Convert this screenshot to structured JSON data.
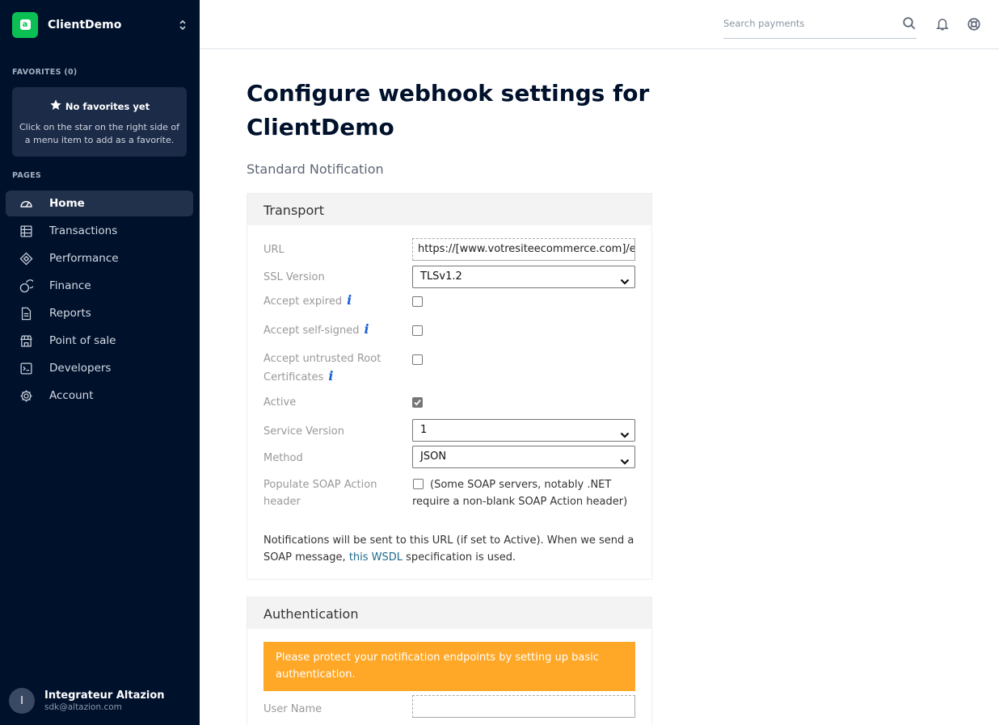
{
  "app": {
    "name": "ClientDemo",
    "logo_letter": "a",
    "brand_color": "#0abf53"
  },
  "sidebar": {
    "favorites_label": "FAVORITES (0)",
    "favorites_empty_title": "No favorites yet",
    "favorites_empty_desc": "Click on the star on the right side of a menu item to add as a favorite.",
    "pages_label": "PAGES",
    "items": [
      {
        "label": "Home",
        "icon": "dashboard-icon",
        "active": true
      },
      {
        "label": "Transactions",
        "icon": "table-icon",
        "active": false
      },
      {
        "label": "Performance",
        "icon": "performance-icon",
        "active": false
      },
      {
        "label": "Finance",
        "icon": "finance-icon",
        "active": false
      },
      {
        "label": "Reports",
        "icon": "document-icon",
        "active": false
      },
      {
        "label": "Point of sale",
        "icon": "store-icon",
        "active": false
      },
      {
        "label": "Developers",
        "icon": "terminal-icon",
        "active": false
      },
      {
        "label": "Account",
        "icon": "gear-icon",
        "active": false
      }
    ],
    "user": {
      "initial": "I",
      "name": "Integrateur Altazion",
      "email": "sdk@altazion.com"
    }
  },
  "topbar": {
    "search_placeholder": "Search payments"
  },
  "main": {
    "title": "Configure webhook settings for ClientDemo",
    "subtitle": "Standard Notification",
    "transport": {
      "heading": "Transport",
      "url_label": "URL",
      "url_value": "https://[www.votresiteecommerce.com]/exe",
      "ssl_label": "SSL Version",
      "ssl_value": "TLSv1.2",
      "accept_expired_label": "Accept expired",
      "accept_self_signed_label": "Accept self-signed",
      "accept_untrusted_label": "Accept untrusted Root Certificates",
      "active_label": "Active",
      "service_version_label": "Service Version",
      "service_version_value": "1",
      "method_label": "Method",
      "method_value": "JSON",
      "soap_label": "Populate SOAP Action header",
      "soap_note": "(Some SOAP servers, notably .NET require a non-blank SOAP Action header)",
      "info_glyph": "i",
      "notice_before": "Notifications will be sent to this URL (if set to Active). When we send a SOAP message, ",
      "notice_link": "this WSDL",
      "notice_after": " specification is used."
    },
    "authentication": {
      "heading": "Authentication",
      "warning": "Please protect your notification endpoints by setting up basic authentication.",
      "warning_color": "#ffa726",
      "username_label": "User Name",
      "username_value": ""
    }
  },
  "checkbox_states": {
    "accept_expired": false,
    "accept_self_signed": false,
    "accept_untrusted": false,
    "active": true,
    "populate_soap": false
  }
}
